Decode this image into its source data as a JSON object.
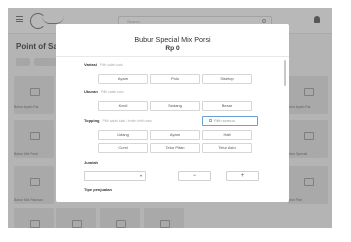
{
  "app": {
    "search_placeholder": "Search",
    "page_title": "Point of Sa",
    "cards": [
      {
        "label": "Bubur Ayam Pai"
      },
      {
        "label": "Bubur Ayam Pai"
      },
      {
        "label": "Bubur Mix Porsi"
      },
      {
        "label": "Bubur Special"
      },
      {
        "label": "Bubur Mix Pakuran"
      },
      {
        "label": "Bubur Pari"
      }
    ]
  },
  "modal": {
    "title": "Bubur Special Mix Porsi",
    "price": "Rp 0",
    "variasi": {
      "label": "Variasi",
      "hint": "Pilih salah satu",
      "options": [
        "Ayam",
        "Polo",
        "Sisetop"
      ]
    },
    "ukuran": {
      "label": "Ukuran",
      "hint": "Pilih salah satu",
      "options": [
        "Kecil",
        "Sedang",
        "Besar"
      ]
    },
    "topping": {
      "label": "Topping",
      "hint": "Pilih salah satu / boleh lebih satu",
      "options": [
        "Udang",
        "Ayam",
        "Hati",
        "Cumi",
        "Telur Pitan",
        "Telur Asin"
      ],
      "extra_option": "Pilih semua"
    },
    "jumlah": {
      "label": "Jumlah",
      "minus": "−",
      "plus": "+"
    },
    "tipe": {
      "label": "Tipe penjualan"
    }
  }
}
